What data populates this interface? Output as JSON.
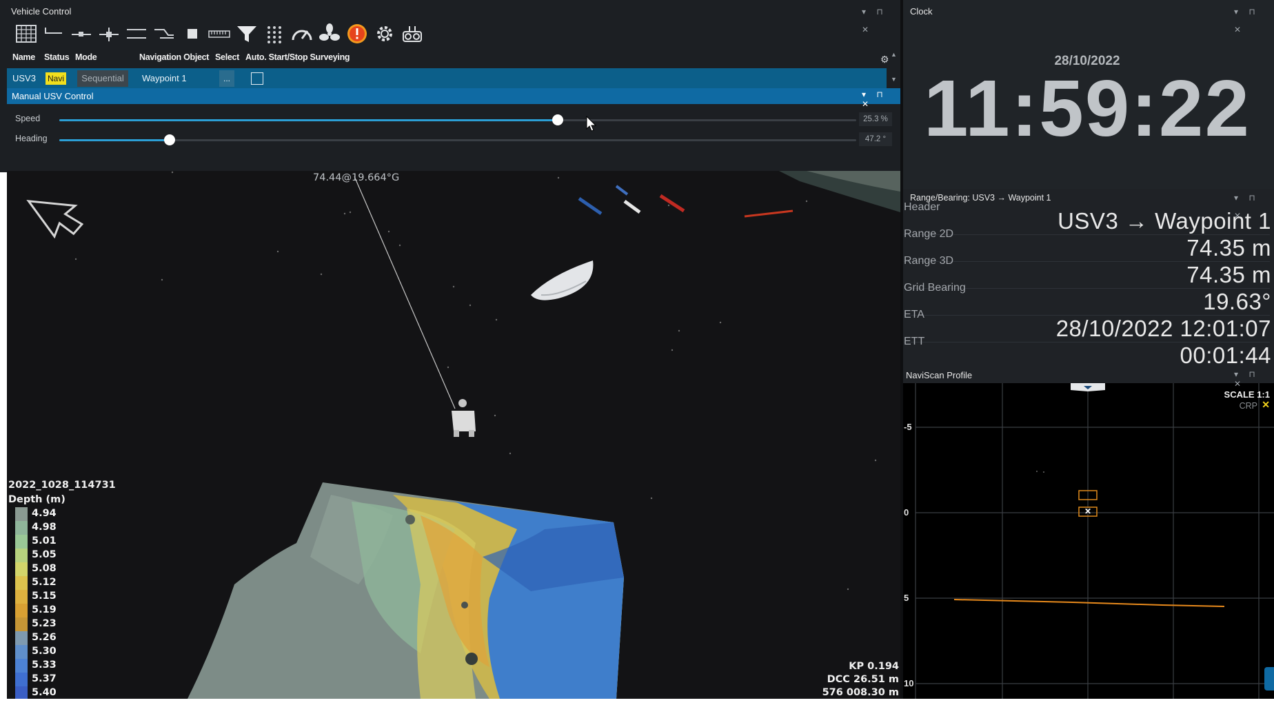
{
  "vehicle_control": {
    "title": "Vehicle Control",
    "columns": [
      "Name",
      "Status",
      "Mode",
      "Navigation Object",
      "Select",
      "Auto. Start/Stop Surveying"
    ],
    "row": {
      "name": "USV3",
      "status": "Navi",
      "mode": "Sequential",
      "navigation_object": "Waypoint 1",
      "select_button": "...",
      "auto_checked": false
    },
    "toolbar_icons": [
      "grid-table-icon",
      "line-dash-icon",
      "line-dot-icon",
      "line-node-icon",
      "parallel-lines-icon",
      "branch-lines-icon",
      "stop-square-icon",
      "ruler-icon",
      "funnel-filter-icon",
      "dot-grid-icon",
      "speedometer-icon",
      "fan-icon",
      "alert-icon",
      "gear-icon",
      "rov-robot-icon"
    ]
  },
  "manual_usv": {
    "title": "Manual USV Control",
    "speed": {
      "label": "Speed",
      "value_text": "25.3 %",
      "fraction": 0.625
    },
    "heading": {
      "label": "Heading",
      "value_text": "47.2 °",
      "fraction": 0.138
    }
  },
  "map_view": {
    "target_label": "74.44@19.664°G",
    "survey_name": "2022_1028_114731",
    "legend_title": "Depth (m)",
    "depth_legend": [
      {
        "value": "4.94",
        "color": "#8a9a92"
      },
      {
        "value": "4.98",
        "color": "#8fb59a"
      },
      {
        "value": "5.01",
        "color": "#9ac896"
      },
      {
        "value": "5.05",
        "color": "#b7d27e"
      },
      {
        "value": "5.08",
        "color": "#d2d56a"
      },
      {
        "value": "5.12",
        "color": "#dcc34e"
      },
      {
        "value": "5.15",
        "color": "#deb13f"
      },
      {
        "value": "5.19",
        "color": "#d8a033"
      },
      {
        "value": "5.23",
        "color": "#c69636"
      },
      {
        "value": "5.26",
        "color": "#7e9ab0"
      },
      {
        "value": "5.30",
        "color": "#5f8fcb"
      },
      {
        "value": "5.33",
        "color": "#4d82d4"
      },
      {
        "value": "5.37",
        "color": "#3f6fd0"
      },
      {
        "value": "5.40",
        "color": "#3a5ec4"
      }
    ],
    "kp": "KP 0.194",
    "dcc": "DCC 26.51 m",
    "easting": "576 008.30 m"
  },
  "clock": {
    "title": "Clock",
    "date": "28/10/2022",
    "time": "11:59:22"
  },
  "range_bearing": {
    "title": "Range/Bearing: USV3 → Waypoint 1",
    "rows": [
      {
        "label": "Header",
        "value": "USV3 → Waypoint 1"
      },
      {
        "label": "Range 2D",
        "value": "74.35 m"
      },
      {
        "label": "Range 3D",
        "value": "74.35 m"
      },
      {
        "label": "Grid Bearing",
        "value": "19.63°"
      },
      {
        "label": "ETA",
        "value": "28/10/2022 12:01:07"
      },
      {
        "label": "ETT",
        "value": "00:01:44"
      }
    ]
  },
  "naviscan": {
    "title": "NaviScan Profile",
    "scale": "SCALE 1:1",
    "crp": "CRP",
    "y_ticks": [
      "-5",
      "0",
      "5",
      "10"
    ]
  },
  "colors": {
    "panel_bg": "#1b1e22",
    "title_bg": "#17191c",
    "accent_blue": "#0f6aa3",
    "slider": "#2b9fd6",
    "status_yellow": "#f2df1d",
    "profile_orange": "#e88a1c"
  }
}
